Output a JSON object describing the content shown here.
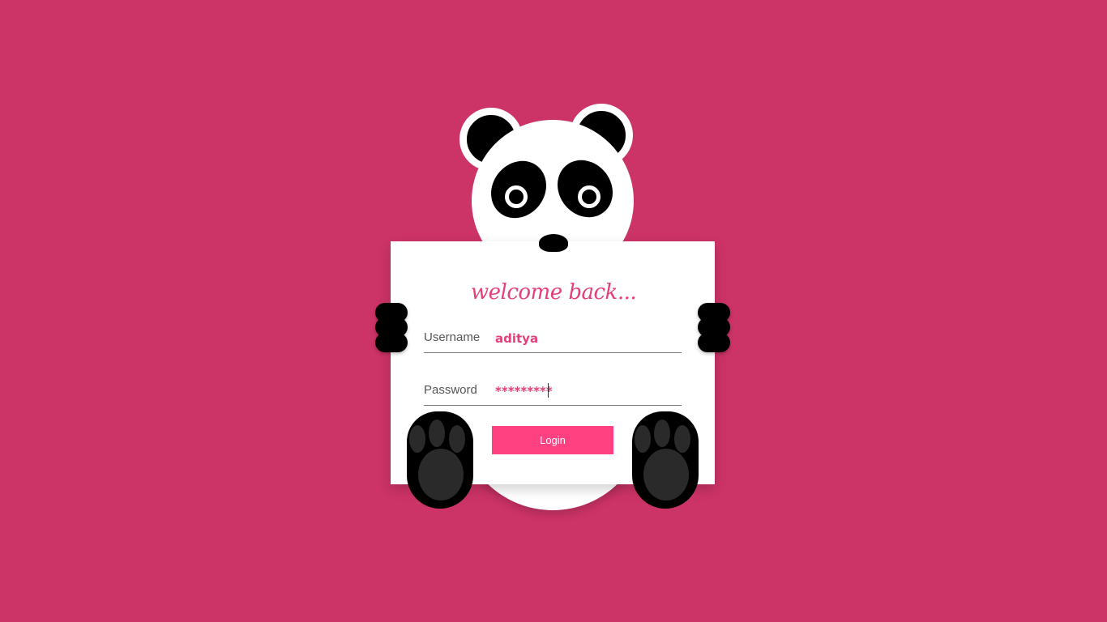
{
  "colors": {
    "background": "#cc3366",
    "accent": "#ff4081",
    "text_accent": "#e43f7b"
  },
  "card": {
    "heading": "welcome back...",
    "username": {
      "label": "Username",
      "value": "aditya"
    },
    "password": {
      "label": "Password",
      "value": "*********"
    },
    "login_label": "Login"
  }
}
